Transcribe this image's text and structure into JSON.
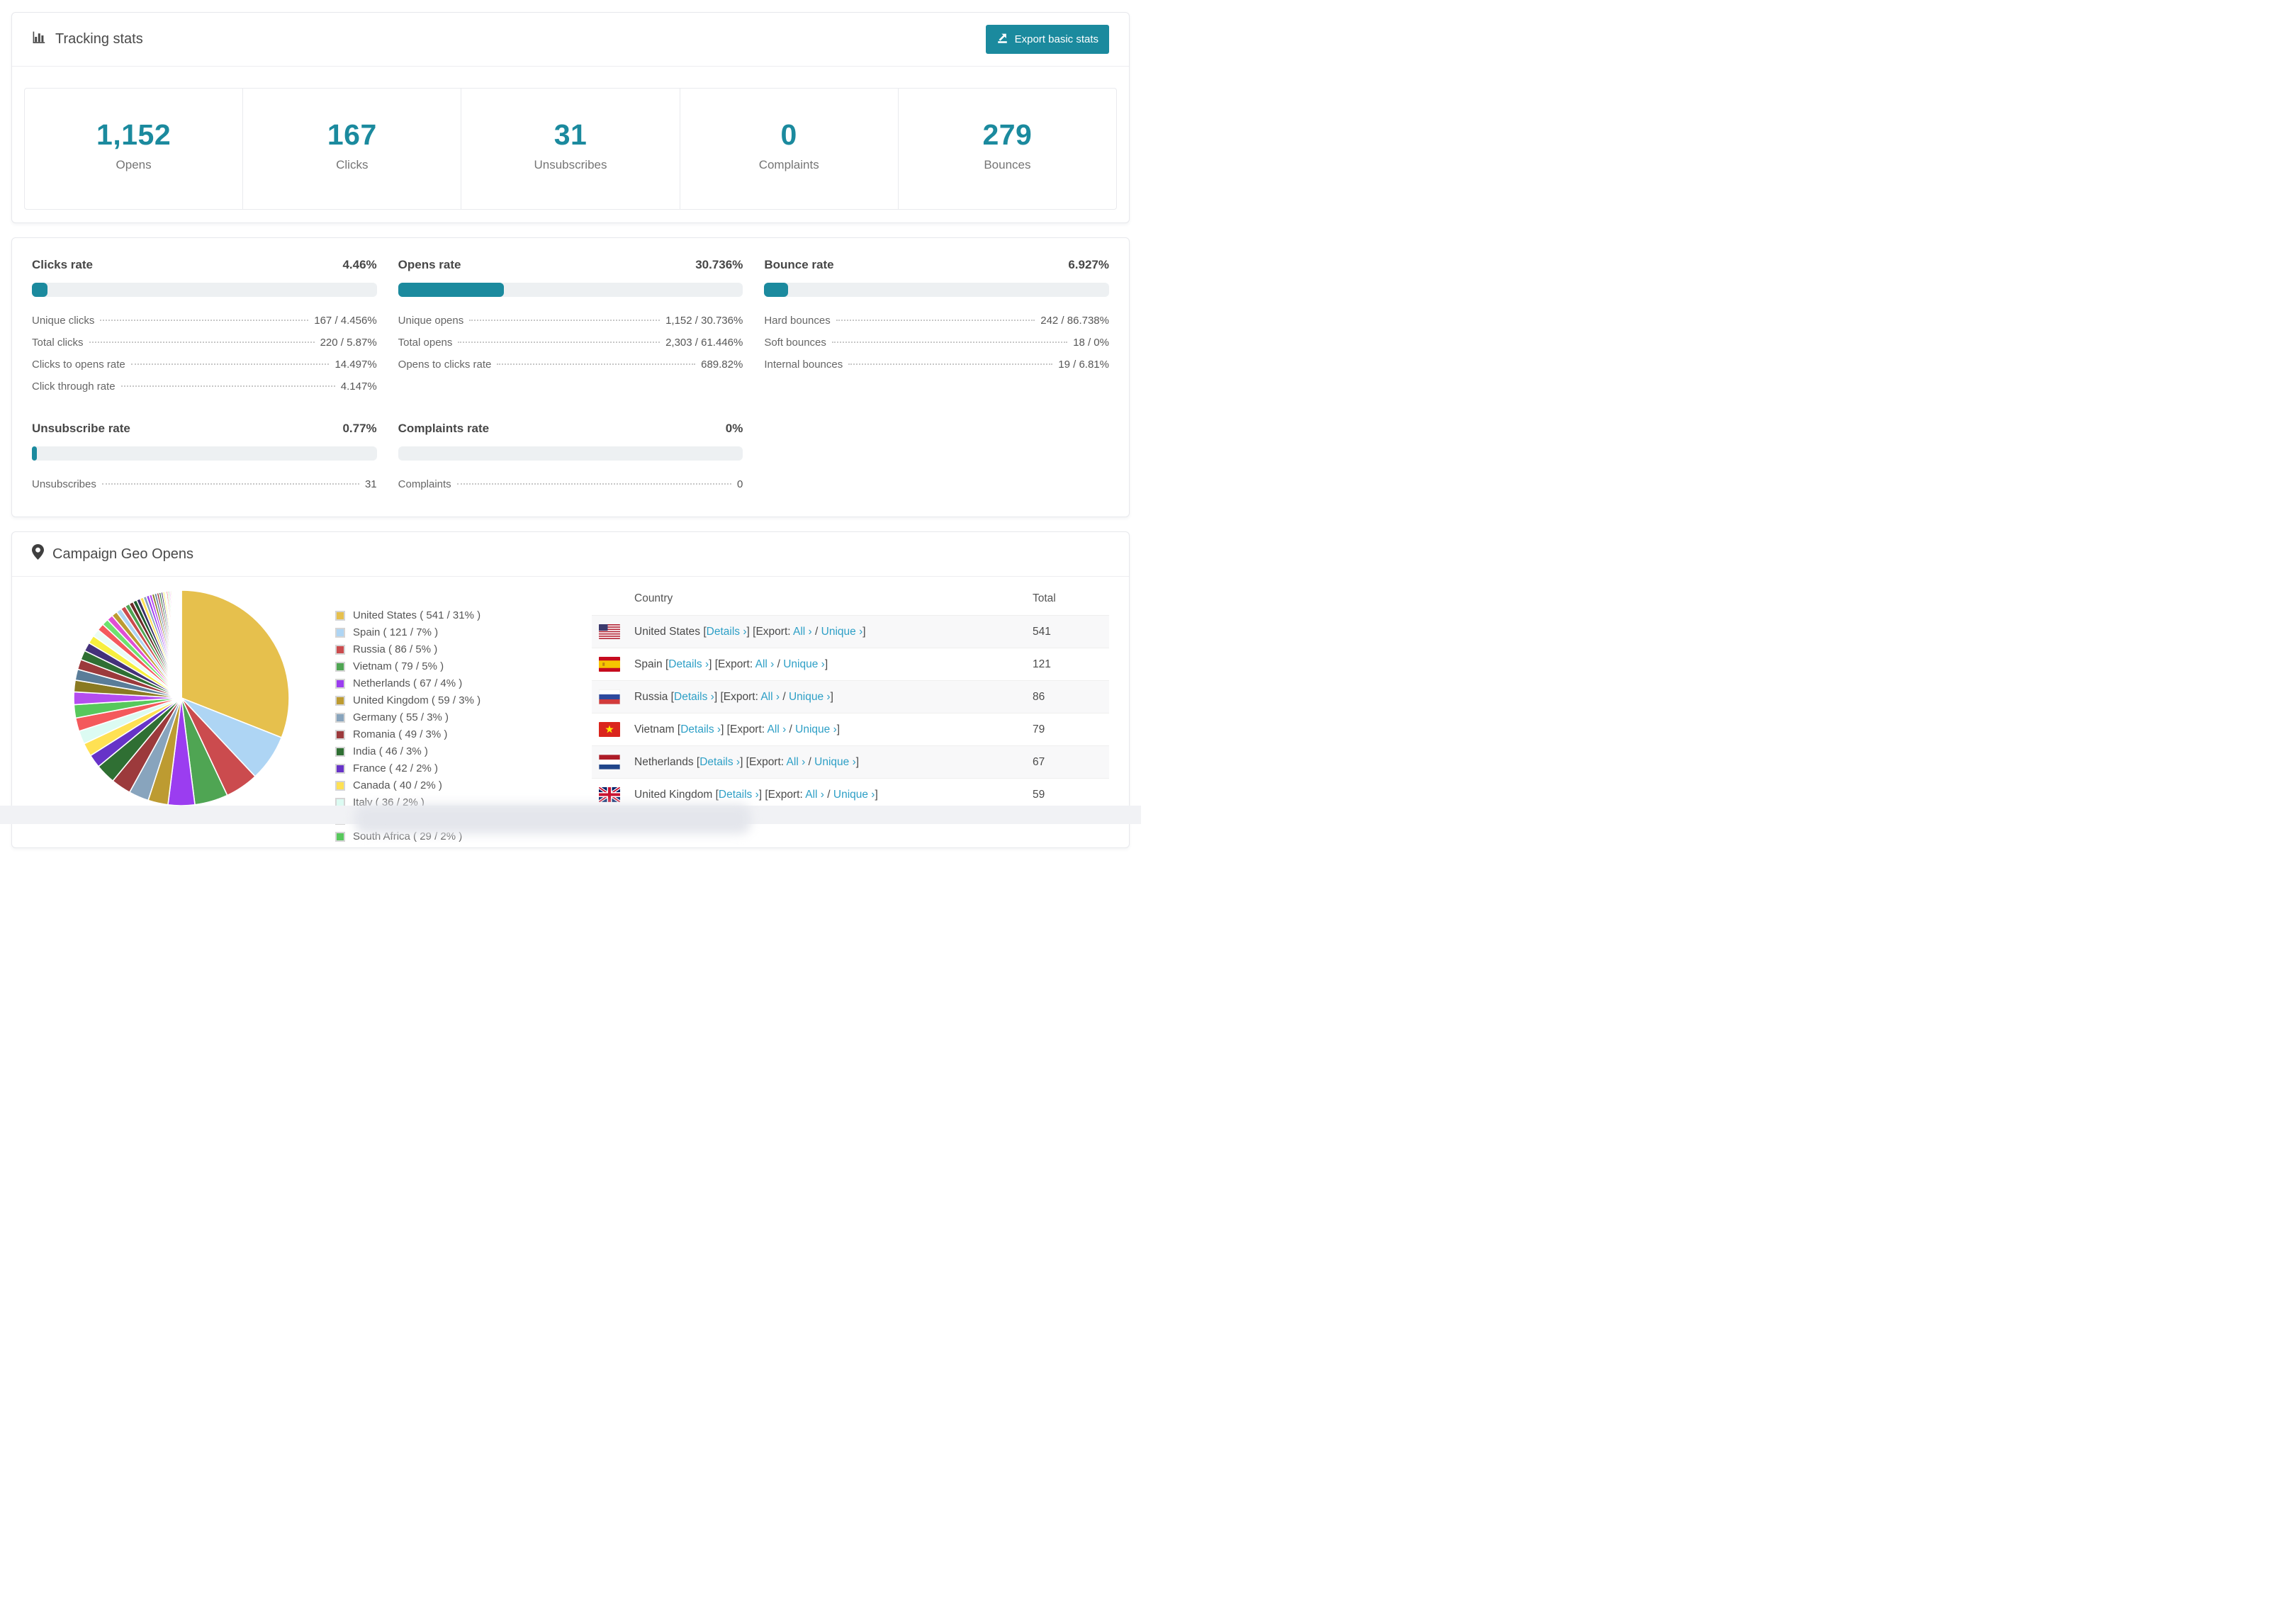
{
  "colors": {
    "accent": "#1b8a9e",
    "link": "#2d9fc6"
  },
  "tracking": {
    "title": "Tracking stats",
    "export_button": "Export basic stats",
    "stats": [
      {
        "value": "1,152",
        "label": "Opens"
      },
      {
        "value": "167",
        "label": "Clicks"
      },
      {
        "value": "31",
        "label": "Unsubscribes"
      },
      {
        "value": "0",
        "label": "Complaints"
      },
      {
        "value": "279",
        "label": "Bounces"
      }
    ]
  },
  "rates": [
    {
      "id": "clicks",
      "title": "Clicks rate",
      "pct": "4.46%",
      "bar_pct": 4.46,
      "rows": [
        [
          "Unique clicks",
          "167 / 4.456%"
        ],
        [
          "Total clicks",
          "220 / 5.87%"
        ],
        [
          "Clicks to opens rate",
          "14.497%"
        ],
        [
          "Click through rate",
          "4.147%"
        ]
      ]
    },
    {
      "id": "opens",
      "title": "Opens rate",
      "pct": "30.736%",
      "bar_pct": 30.736,
      "rows": [
        [
          "Unique opens",
          "1,152 / 30.736%"
        ],
        [
          "Total opens",
          "2,303 / 61.446%"
        ],
        [
          "Opens to clicks rate",
          "689.82%"
        ]
      ]
    },
    {
      "id": "bounce",
      "title": "Bounce rate",
      "pct": "6.927%",
      "bar_pct": 6.927,
      "rows": [
        [
          "Hard bounces",
          "242 / 86.738%"
        ],
        [
          "Soft bounces",
          "18 / 0%"
        ],
        [
          "Internal bounces",
          "19 / 6.81%"
        ]
      ]
    },
    {
      "id": "unsubscribe",
      "title": "Unsubscribe rate",
      "pct": "0.77%",
      "bar_pct": 0.77,
      "rows": [
        [
          "Unsubscribes",
          "31"
        ]
      ]
    },
    {
      "id": "complaints",
      "title": "Complaints rate",
      "pct": "0%",
      "bar_pct": 0,
      "rows": [
        [
          "Complaints",
          "0"
        ]
      ]
    }
  ],
  "geo": {
    "title": "Campaign Geo Opens",
    "legend_format": "{label} ( {value} / {pct}% )",
    "table": {
      "headers": [
        "Country",
        "Total"
      ],
      "labels": {
        "details": "Details",
        "export_prefix": "Export:",
        "all": "All",
        "unique": "Unique",
        "chevron": "›",
        "open": "[",
        "close": "]",
        "slash": "/"
      },
      "rows": [
        {
          "country": "United States",
          "flag": "us",
          "total": "541"
        },
        {
          "country": "Spain",
          "flag": "es",
          "total": "121"
        },
        {
          "country": "Russia",
          "flag": "ru",
          "total": "86"
        },
        {
          "country": "Vietnam",
          "flag": "vn",
          "total": "79"
        },
        {
          "country": "Netherlands",
          "flag": "nl",
          "total": "67"
        },
        {
          "country": "United Kingdom",
          "flag": "gb",
          "total": "59"
        }
      ],
      "partial_row": true
    },
    "chart_data": {
      "type": "pie",
      "title": "Campaign Geo Opens",
      "legend_position": "right",
      "slices": [
        {
          "label": "United States",
          "value": 541,
          "pct": 31,
          "color": "#e6c04d"
        },
        {
          "label": "Spain",
          "value": 121,
          "pct": 7,
          "color": "#aed5f4"
        },
        {
          "label": "Russia",
          "value": 86,
          "pct": 5,
          "color": "#cb4b4e"
        },
        {
          "label": "Vietnam",
          "value": 79,
          "pct": 5,
          "color": "#4fa553"
        },
        {
          "label": "Netherlands",
          "value": 67,
          "pct": 4,
          "color": "#9b3df0"
        },
        {
          "label": "United Kingdom",
          "value": 59,
          "pct": 3,
          "color": "#bd9b31"
        },
        {
          "label": "Germany",
          "value": 55,
          "pct": 3,
          "color": "#88a4bd"
        },
        {
          "label": "Romania",
          "value": 49,
          "pct": 3,
          "color": "#9c3a3c"
        },
        {
          "label": "India",
          "value": 46,
          "pct": 3,
          "color": "#2f6f33"
        },
        {
          "label": "France",
          "value": 42,
          "pct": 2,
          "color": "#6733c8"
        },
        {
          "label": "Canada",
          "value": 40,
          "pct": 2,
          "color": "#ffe153"
        },
        {
          "label": "Italy",
          "value": 36,
          "pct": 2,
          "color": "#dcfbf2"
        },
        {
          "label": "Brazil",
          "value": 33,
          "pct": 2,
          "color": "#f4595c"
        },
        {
          "label": "South Africa",
          "value": 29,
          "pct": 2,
          "color": "#57c85c"
        }
      ],
      "others": {
        "total_pct": 26,
        "count": 45,
        "decay": 0.93,
        "palette": [
          "#b44df0",
          "#8a7a22",
          "#5a7d99",
          "#9c3a3c",
          "#2f6f33",
          "#44317a",
          "#f7ef3e",
          "#eafcf6",
          "#f4595c",
          "#6ee26e",
          "#e04fd4",
          "#bd9b31",
          "#aed5f4",
          "#cb4b4e",
          "#4fa553",
          "#6e2a2a",
          "#1e5c2e",
          "#3b2f66",
          "#ffe153",
          "#88a4bd",
          "#9b3df0"
        ]
      }
    }
  }
}
